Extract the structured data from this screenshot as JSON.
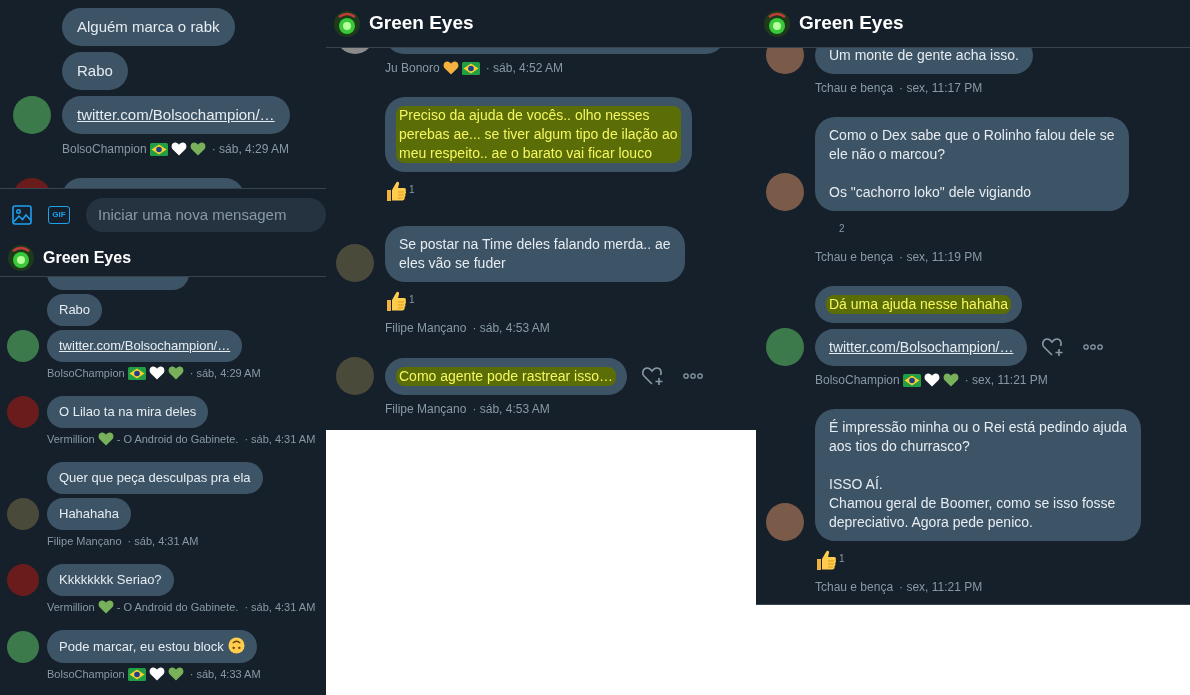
{
  "panels": [
    {
      "blocks": [
        {
          "kind": "messages",
          "items": [
            {
              "bubbles": [
                {
                  "kind": "text",
                  "text": "Alguém marca o rabk",
                  "highlighted": false
                },
                {
                  "kind": "text",
                  "text": "Rabo",
                  "highlighted": false
                },
                {
                  "kind": "link",
                  "text": "twitter.com/Bolsochampion/…",
                  "highlighted": false
                }
              ],
              "avatar": {
                "color": "#3c7a4c"
              },
              "actions": false,
              "meta": {
                "parts": [
                  {
                    "kind": "text",
                    "text": "BolsoChampion"
                  },
                  {
                    "kind": "flag"
                  },
                  {
                    "kind": "heart",
                    "color": "#ffffff"
                  },
                  {
                    "kind": "heart",
                    "color": "#78b159"
                  }
                ],
                "time": "· sáb, 4:29 AM"
              }
            },
            {
              "bubbles": [
                {
                  "kind": "stub"
                }
              ],
              "avatar": {
                "color": "#6a1c1c"
              },
              "actions": false
            }
          ]
        },
        {
          "kind": "composer",
          "gif": "GIF",
          "placeholder": "Iniciar uma nova mensagem"
        },
        {
          "kind": "header",
          "title": "Green Eyes"
        },
        {
          "kind": "messages",
          "items": [
            {
              "bubbles": [
                {
                  "kind": "stub"
                },
                {
                  "kind": "text",
                  "text": "Rabo",
                  "highlighted": false
                },
                {
                  "kind": "link",
                  "text": "twitter.com/Bolsochampion/…",
                  "highlighted": false
                }
              ],
              "avatar": {
                "color": "#3c7a4c"
              },
              "actions": false,
              "meta": {
                "parts": [
                  {
                    "kind": "text",
                    "text": "BolsoChampion"
                  },
                  {
                    "kind": "flag"
                  },
                  {
                    "kind": "heart",
                    "color": "#ffffff"
                  },
                  {
                    "kind": "heart",
                    "color": "#78b159"
                  }
                ],
                "time": "· sáb, 4:29 AM"
              }
            },
            {
              "bubbles": [
                {
                  "kind": "text",
                  "text": "O Lilao ta na mira deles",
                  "highlighted": false
                }
              ],
              "avatar": {
                "color": "#6a1c1c"
              },
              "actions": false,
              "meta": {
                "parts": [
                  {
                    "kind": "text",
                    "text": "Vermillion"
                  },
                  {
                    "kind": "heart",
                    "color": "#78b159"
                  },
                  {
                    "kind": "text",
                    "text": "- O Android do Gabinete."
                  }
                ],
                "time": "· sáb, 4:31 AM"
              }
            },
            {
              "bubbles": [
                {
                  "kind": "text",
                  "text": "Quer que peça desculpas pra ela",
                  "highlighted": false
                },
                {
                  "kind": "text",
                  "text": "Hahahaha",
                  "highlighted": false
                }
              ],
              "avatar": {
                "color": "#4a4a3a"
              },
              "actions": false,
              "meta": {
                "parts": [
                  {
                    "kind": "text",
                    "text": "Filipe Mançano"
                  }
                ],
                "time": "· sáb, 4:31 AM"
              }
            },
            {
              "bubbles": [
                {
                  "kind": "text",
                  "text": "Kkkkkkkk Seriao?",
                  "highlighted": false
                }
              ],
              "avatar": {
                "color": "#6a1c1c"
              },
              "actions": false,
              "meta": {
                "parts": [
                  {
                    "kind": "text",
                    "text": "Vermillion"
                  },
                  {
                    "kind": "heart",
                    "color": "#78b159"
                  },
                  {
                    "kind": "text",
                    "text": "- O Android do Gabinete."
                  }
                ],
                "time": "· sáb, 4:31 AM"
              }
            },
            {
              "bubbles": [
                {
                  "kind": "text",
                  "text": "Pode marcar, eu estou block",
                  "highlighted": false,
                  "emoji": {
                    "kind": "upside-down"
                  }
                }
              ],
              "avatar": {
                "color": "#3c7a4c"
              },
              "actions": false,
              "meta": {
                "parts": [
                  {
                    "kind": "text",
                    "text": "BolsoChampion"
                  },
                  {
                    "kind": "flag"
                  },
                  {
                    "kind": "heart",
                    "color": "#ffffff"
                  },
                  {
                    "kind": "heart",
                    "color": "#78b159"
                  }
                ],
                "time": "· sáb, 4:33 AM"
              }
            }
          ]
        }
      ]
    },
    {
      "blocks": [
        {
          "kind": "header",
          "title": "Green Eyes"
        },
        {
          "kind": "messages",
          "items": [
            {
              "bubbles": [
                {
                  "kind": "stub"
                }
              ],
              "avatar": {
                "color": "#8a8a8a"
              },
              "actions": false,
              "meta": {
                "parts": [
                  {
                    "kind": "text",
                    "text": "Ju Bonoro"
                  },
                  {
                    "kind": "heart",
                    "color": "#f4b13f"
                  },
                  {
                    "kind": "flag"
                  }
                ],
                "time": "· sáb, 4:52 AM"
              }
            },
            {
              "bubbles": [
                {
                  "kind": "text",
                  "text": "Preciso da ajuda de vocês.. olho nesses\nperebas ae... se tiver algum tipo de ilação ao\nmeu respeito.. ae o barato vai ficar louco",
                  "highlighted": true
                }
              ],
              "actions": false,
              "reaction": {
                "kind": "thumbs-up",
                "count": "1"
              }
            },
            {
              "bubbles": [
                {
                  "kind": "text",
                  "text": "Se postar na Time deles falando merda.. ae\neles vão se fuder",
                  "highlighted": false
                }
              ],
              "avatar": {
                "color": "#4a4a3a"
              },
              "actions": false,
              "reaction": {
                "kind": "thumbs-up",
                "count": "1"
              },
              "meta": {
                "parts": [
                  {
                    "kind": "text",
                    "text": "Filipe Mançano"
                  }
                ],
                "time": "· sáb, 4:53 AM"
              }
            },
            {
              "bubbles": [
                {
                  "kind": "text",
                  "text": "Como agente pode rastrear isso…",
                  "highlighted": true
                }
              ],
              "avatar": {
                "color": "#4a4a3a"
              },
              "actions": true,
              "meta": {
                "parts": [
                  {
                    "kind": "text",
                    "text": "Filipe Mançano"
                  }
                ],
                "time": "· sáb, 4:53 AM"
              }
            }
          ]
        }
      ]
    },
    {
      "blocks": [
        {
          "kind": "header",
          "title": "Green Eyes"
        },
        {
          "kind": "messages",
          "items": [
            {
              "bubbles": [
                {
                  "kind": "text",
                  "text": "Um monte de gente acha isso.",
                  "highlighted": false
                }
              ],
              "avatar": {
                "color": "#7a5a48"
              },
              "actions": false,
              "meta": {
                "parts": [
                  {
                    "kind": "text",
                    "text": "Tchau e bença"
                  }
                ],
                "time": "· sex, 11:17 PM"
              }
            },
            {
              "bubbles": [
                {
                  "kind": "text",
                  "text": "Como o Dex sabe que o Rolinho falou dele se\nele não o marcou?\n\nOs \"cachorro loko\" dele vigiando",
                  "highlighted": false
                }
              ],
              "avatar": {
                "color": "#7a5a48"
              },
              "actions": false,
              "reaction": {
                "kind": "blank",
                "count": "2"
              },
              "meta": {
                "parts": [
                  {
                    "kind": "text",
                    "text": "Tchau e bença"
                  }
                ],
                "time": "· sex, 11:19 PM"
              }
            },
            {
              "bubbles": [
                {
                  "kind": "text",
                  "text": "Dá uma ajuda nesse hahaha",
                  "highlighted": true
                },
                {
                  "kind": "link",
                  "text": "twitter.com/Bolsochampion/…",
                  "highlighted": false
                }
              ],
              "avatar": {
                "color": "#3c7a4c"
              },
              "actions": true,
              "meta": {
                "parts": [
                  {
                    "kind": "text",
                    "text": "BolsoChampion"
                  },
                  {
                    "kind": "flag"
                  },
                  {
                    "kind": "heart",
                    "color": "#ffffff"
                  },
                  {
                    "kind": "heart",
                    "color": "#78b159"
                  }
                ],
                "time": "· sex, 11:21 PM"
              }
            },
            {
              "bubbles": [
                {
                  "kind": "text",
                  "text": "É impressão minha ou o Rei está pedindo ajuda\naos tios do churrasco?\n\nISSO AÍ.\nChamou geral de Boomer, como se isso fosse\ndepreciativo. Agora pede penico.",
                  "highlighted": false
                }
              ],
              "avatar": {
                "color": "#7a5a48"
              },
              "actions": false,
              "reaction": {
                "kind": "thumbs-up",
                "count": "1"
              },
              "meta": {
                "parts": [
                  {
                    "kind": "text",
                    "text": "Tchau e bença"
                  }
                ],
                "time": "· sex, 11:21 PM"
              }
            }
          ]
        }
      ]
    }
  ]
}
